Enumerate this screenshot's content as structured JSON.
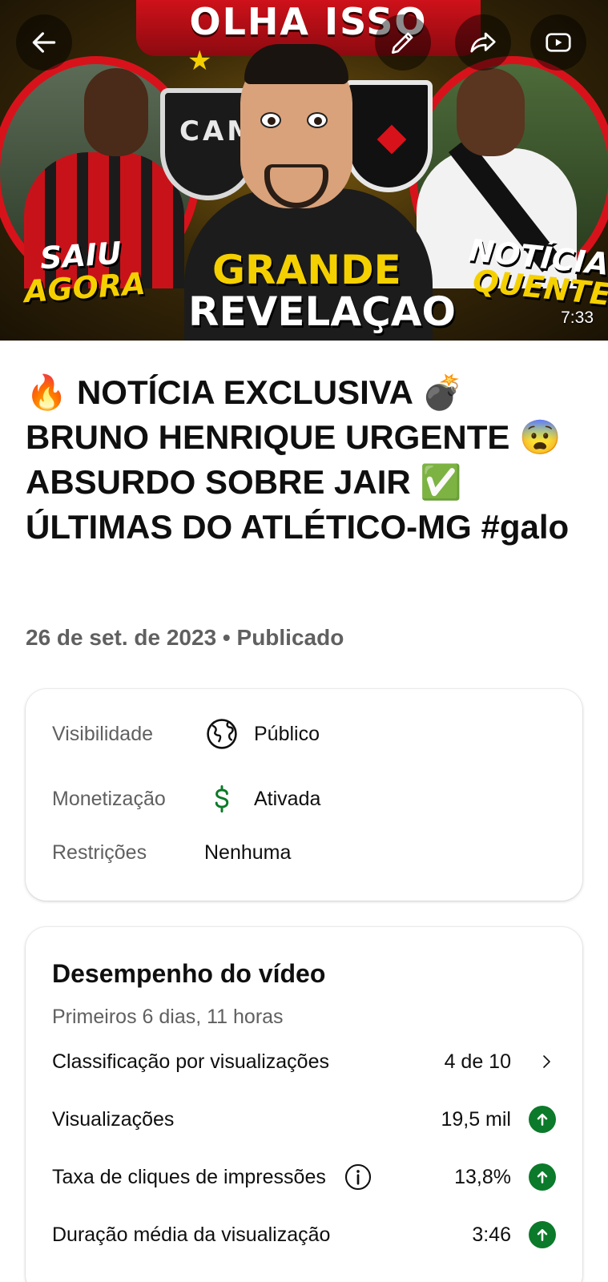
{
  "video": {
    "duration": "7:33",
    "thumbnail_text": {
      "banner": "OLHA ISSO",
      "saiu": "SAIU",
      "agora": "AGORA",
      "grande": "GRANDE",
      "revelacao": "REVELAÇAO",
      "noticia": "NOTÍCIA",
      "quente": "QUENTE",
      "crest": "CAM"
    },
    "title": "🔥 NOTÍCIA EXCLUSIVA 💣 BRUNO HENRIQUE URGENTE 😨 ABSURDO SOBRE JAIR ✅ ÚLTIMAS DO ATLÉTICO-MG #galo",
    "meta": "26 de set. de 2023 • Publicado"
  },
  "top_actions": {
    "back_icon": "arrow-left-icon",
    "edit_icon": "pencil-icon",
    "share_icon": "share-icon",
    "youtube_icon": "youtube-play-icon"
  },
  "details": {
    "visibility": {
      "label": "Visibilidade",
      "value": "Público",
      "icon": "globe-icon"
    },
    "monetization": {
      "label": "Monetização",
      "value": "Ativada",
      "icon": "dollar-icon",
      "color": "#0b7a2a"
    },
    "restrictions": {
      "label": "Restrições",
      "value": "Nenhuma"
    }
  },
  "performance": {
    "title": "Desempenho do vídeo",
    "subtitle": "Primeiros 6 dias, 11 horas",
    "metrics": [
      {
        "label": "Classificação por visualizações",
        "value": "4 de 10",
        "trailing": "chevron-right-icon"
      },
      {
        "label": "Visualizações",
        "value": "19,5 mil",
        "trailing": "arrow-up-circle-icon"
      },
      {
        "label": "Taxa de cliques de impressões",
        "value": "13,8%",
        "trailing": "arrow-up-circle-icon",
        "info": "info-icon"
      },
      {
        "label": "Duração média da visualização",
        "value": "3:46",
        "trailing": "arrow-up-circle-icon"
      }
    ],
    "up_color": "#0b7a2a"
  }
}
